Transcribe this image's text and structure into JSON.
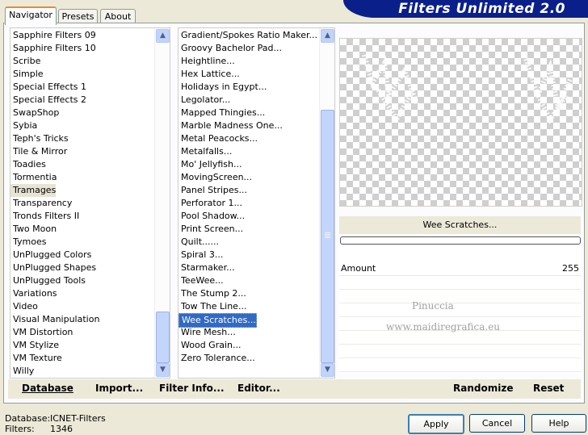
{
  "header": {
    "title": "Filters Unlimited 2.0"
  },
  "tabs": [
    {
      "label": "Navigator",
      "active": true
    },
    {
      "label": "Presets",
      "active": false
    },
    {
      "label": "About",
      "active": false
    }
  ],
  "categories": [
    "Sapphire Filters 09",
    "Sapphire Filters 10",
    "Scribe",
    "Simple",
    "Special Effects 1",
    "Special Effects 2",
    "SwapShop",
    "Sybia",
    "Teph's Tricks",
    "Tile & Mirror",
    "Toadies",
    "Tormentia",
    "Tramages",
    "Transparency",
    "Tronds Filters II",
    "Two Moon",
    "Tymoes",
    "UnPlugged Colors",
    "UnPlugged Shapes",
    "UnPlugged Tools",
    "Variations",
    "Video",
    "Visual Manipulation",
    "VM Distortion",
    "VM Stylize",
    "VM Texture",
    "Willy"
  ],
  "selected_category": "Tramages",
  "filters": [
    "Gradient/Spokes Ratio Maker...",
    "Groovy Bachelor Pad...",
    "Heightline...",
    "Hex Lattice...",
    "Holidays in Egypt...",
    "Legolator...",
    "Mapped Thingies...",
    "Marble Madness One...",
    "Metal Peacocks...",
    "Metalfalls...",
    "Mo' Jellyfish...",
    "MovingScreen...",
    "Panel Stripes...",
    "Perforator 1...",
    "Pool Shadow...",
    "Print Screen...",
    "Quilt......",
    "Spiral 3...",
    "Starmaker...",
    "TeeWee...",
    "The Stump 2...",
    "Tow The Line...",
    "Wee Scratches...",
    "Wire Mesh...",
    "Wood Grain...",
    "Zero Tolerance..."
  ],
  "selected_filter": "Wee Scratches...",
  "preview": {
    "filter_name": "Wee Scratches..."
  },
  "params": [
    {
      "label": "Amount",
      "value": "255"
    }
  ],
  "watermark": {
    "line1": "Pinuccia",
    "line2": "www.maidiregrafica.eu"
  },
  "left_buttons": {
    "database": "Database",
    "import": "Import...",
    "filter_info": "Filter Info...",
    "editor": "Editor..."
  },
  "right_buttons": {
    "randomize": "Randomize",
    "reset": "Reset"
  },
  "status": {
    "database_label": "Database:",
    "database_value": "ICNET-Filters",
    "filters_label": "Filters:",
    "filters_value": "1346"
  },
  "dialog_buttons": {
    "apply": "Apply",
    "cancel": "Cancel",
    "help": "Help"
  },
  "colors": {
    "banner": "#0a1f8a",
    "selection": "#316ac5",
    "dialog_bg": "#ece9d8",
    "scroll": "#c4d5fc"
  }
}
